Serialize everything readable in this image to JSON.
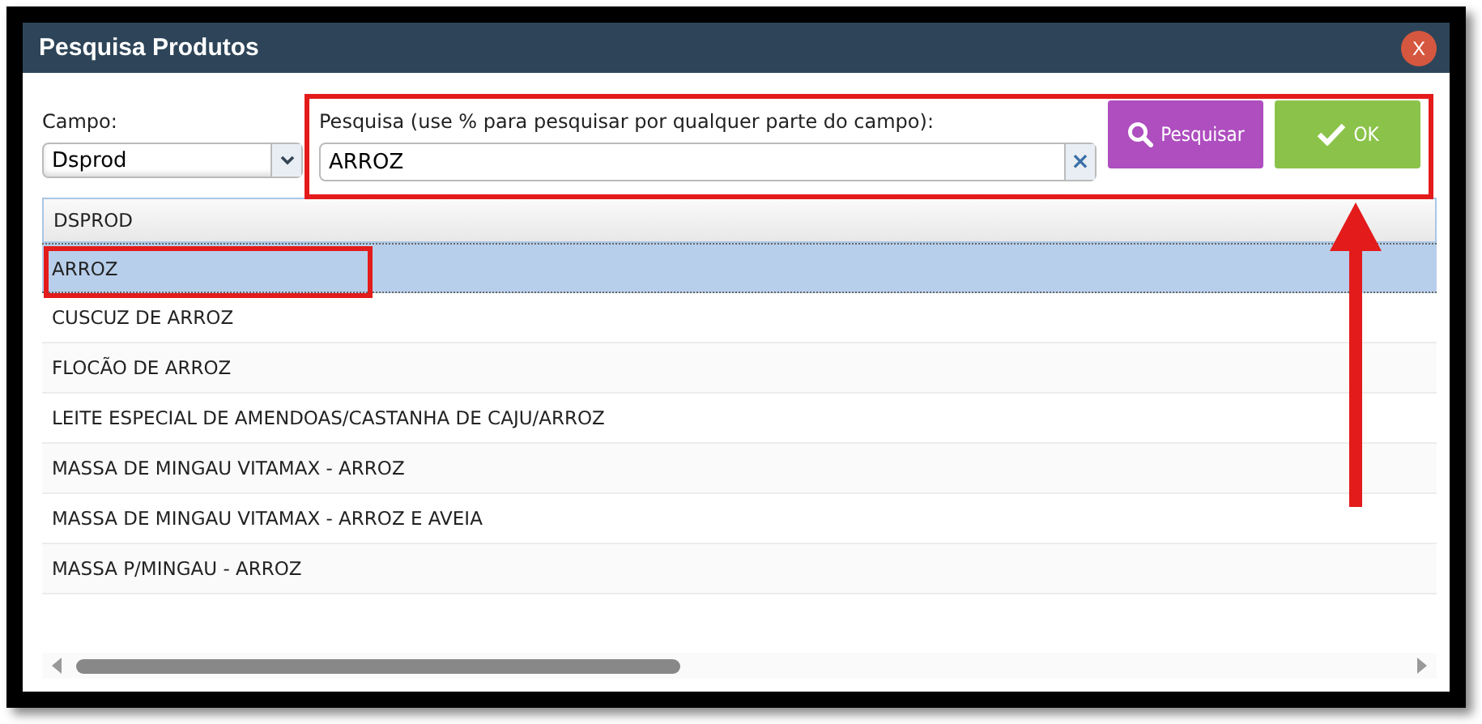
{
  "window": {
    "title": "Pesquisa Produtos",
    "close": "X"
  },
  "field": {
    "label": "Campo:",
    "value": "Dsprod"
  },
  "search": {
    "label": "Pesquisa (use % para pesquisar por qualquer parte do campo):",
    "value": "ARROZ",
    "clear": "×"
  },
  "buttons": [
    {
      "kind": "search",
      "label": "Pesquisar"
    },
    {
      "kind": "ok",
      "label": "OK"
    }
  ],
  "table": {
    "columns": [
      "DSPROD"
    ],
    "rows": [
      {
        "cells": [
          "ARROZ"
        ],
        "selected": true
      },
      {
        "cells": [
          "CUSCUZ DE ARROZ"
        ],
        "selected": false
      },
      {
        "cells": [
          "FLOCÃO DE ARROZ"
        ],
        "selected": false
      },
      {
        "cells": [
          "LEITE ESPECIAL DE AMENDOAS/CASTANHA DE CAJU/ARROZ"
        ],
        "selected": false
      },
      {
        "cells": [
          "MASSA DE MINGAU VITAMAX - ARROZ"
        ],
        "selected": false
      },
      {
        "cells": [
          "MASSA DE MINGAU VITAMAX - ARROZ E AVEIA"
        ],
        "selected": false
      },
      {
        "cells": [
          "MASSA P/MINGAU - ARROZ"
        ],
        "selected": false
      }
    ]
  }
}
